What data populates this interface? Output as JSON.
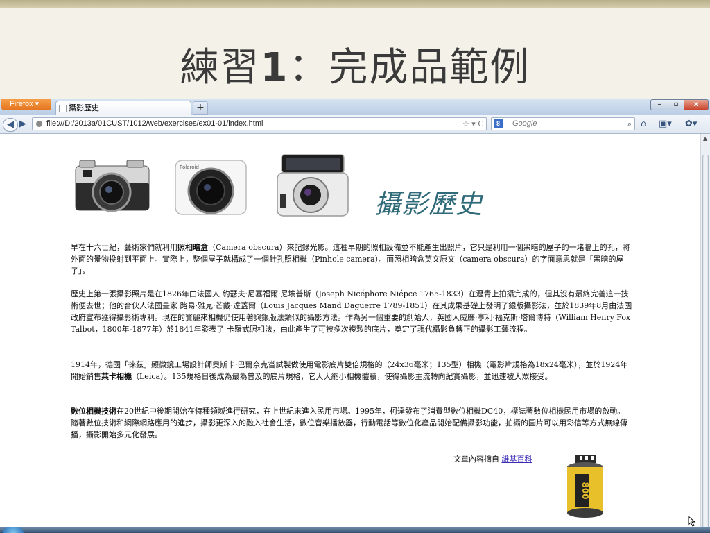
{
  "slide": {
    "title_prefix": "練習",
    "title_number": "1",
    "title_suffix": "：完成品範例"
  },
  "browser": {
    "menu_button": "Firefox ▾",
    "tab_title": "攝影歷史",
    "new_tab": "+",
    "url": "file:///D:/2013a/01CUST/1012/web/exercises/ex01-01/index.html",
    "url_controls": "☆ ▾ C",
    "search_placeholder": "Google",
    "window_min": "–",
    "window_max": "▫",
    "window_close": "x"
  },
  "page": {
    "heading": "攝影歷史",
    "p1": {
      "a": "早在十六世紀，藝術家們就利用",
      "b": "照相暗盒",
      "c": "（Camera obscura）來記錄光影。這種早期的照相設備並不能產生出照片，它只是利用一個黑暗的屋子的一堵牆上的孔，將外面的景物投射到平面上。實際上，整個屋子就構成了一個針孔照相機（Pinhole camera）。而照相暗盒英文原文（camera obscura）的字面意思就是「黑暗的屋子」。"
    },
    "p2": "歷史上第一張攝影照片是在1826年由法國人 約瑟夫·尼塞福爾·尼埃普斯（Joseph Nicéphore Niépce 1765-1833）在瀝青上拍攝完成的，但其沒有最終完善這一技術便去世；他的合伙人法國畫家 路易·雅克·芒戴·達蓋爾（Louis Jacques Mand Daguerre 1789-1851）在其成果基礎上發明了銀版攝影法，並於1839年8月由法國政府宣布獲得攝影術專利。現在的寶麗來相機仍使用著與銀版法類似的攝影方法。作為另一個重要的創始人，英國人威廉·亨利·福克斯·塔爾博特（William Henry Fox Talbot，1800年-1877年）於1841年發表了 卡羅式照相法，由此產生了可被多次複製的底片，奠定了現代攝影負轉正的攝影工藝流程。",
    "p3": {
      "a": "1914年，德國「徠茲」顯微鏡工場設計師奧斯卡·巴爾奈克嘗試製做使用電影底片雙倍規格的（24x36毫米；135型）相機（電影片規格為18x24毫米），並於1924年開始銷售",
      "b": "萊卡相機",
      "c": "（Leica）。135規格日後成為最為普及的底片規格，它大大縮小相機體積，使得攝影主流轉向紀實攝影，並迅速被大眾接受。"
    },
    "p4": {
      "a": "數位相機技術",
      "b": "在20世紀中後期開始在特種領域進行研究，在上世紀末進入民用市場。1995年，柯達發布了消費型數位相機DC40，標誌著數位相機民用市場的啟動。隨著數位技術和網際網路應用的進步，攝影更深入的融入社會生活，數位音樂播放器，行動電話等數位化產品開始配備攝影功能，拍攝的圖片可以用彩信等方式無線傳播，攝影開始多元化發展。"
    },
    "source_prefix": "文章內容摘自",
    "source_link": "維基百科",
    "film_label": "800"
  },
  "colors": {
    "heading": "#2f6a78",
    "link": "#3a2db5",
    "firefox_orange": "#e4731f"
  }
}
